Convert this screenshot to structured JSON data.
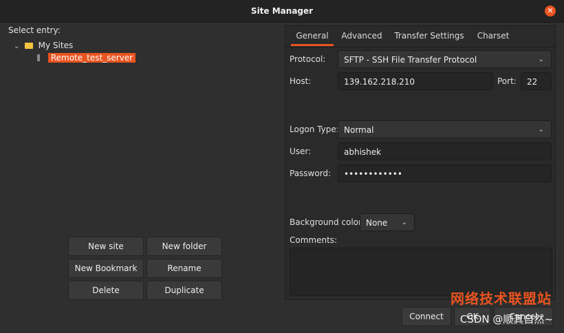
{
  "window": {
    "title": "Site Manager"
  },
  "left": {
    "select_entry_label": "Select entry:",
    "tree": {
      "root_label": "My Sites",
      "site_label": "Remote_test_server"
    }
  },
  "buttons": {
    "new_site": "New site",
    "new_folder": "New folder",
    "new_bookmark": "New Bookmark",
    "rename": "Rename",
    "delete": "Delete",
    "duplicate": "Duplicate"
  },
  "tabs": {
    "general": "General",
    "advanced": "Advanced",
    "transfer_settings": "Transfer Settings",
    "charset": "Charset"
  },
  "form": {
    "protocol_label": "Protocol:",
    "protocol_value": "SFTP - SSH File Transfer Protocol",
    "host_label": "Host:",
    "host_value": "139.162.218.210",
    "port_label": "Port:",
    "port_value": "22",
    "logon_type_label": "Logon Type:",
    "logon_type_value": "Normal",
    "user_label": "User:",
    "user_value": "abhishek",
    "password_label": "Password:",
    "password_value": "••••••••••••",
    "background_color_label": "Background color:",
    "background_color_value": "None",
    "comments_label": "Comments:"
  },
  "bottom": {
    "connect_label": "Connect",
    "ok_label": "OK",
    "cancel_label": "Cancel"
  },
  "watermark": {
    "line1": "网络技术联盟站",
    "line2": "CSDN @顺其自然~"
  },
  "colors": {
    "accent": "#e95420"
  }
}
